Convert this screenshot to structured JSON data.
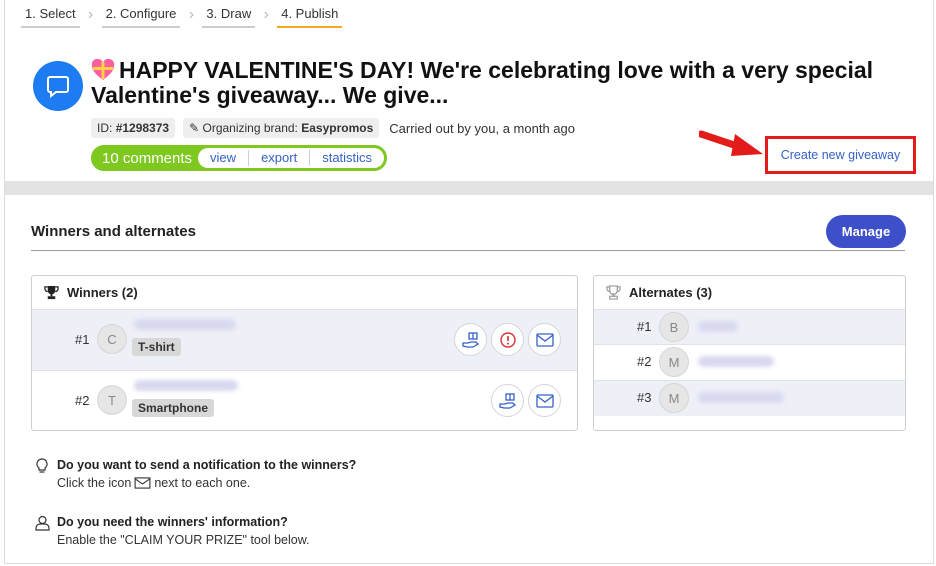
{
  "steps": [
    "1. Select",
    "2. Configure",
    "3. Draw",
    "4. Publish"
  ],
  "active_step": 3,
  "giveaway": {
    "title": "HAPPY VALENTINE'S DAY! We're celebrating love with a very special Valentine's giveaway... We give...",
    "id_label": "ID:",
    "id_value": "#1298373",
    "brand_label": "Organizing brand:",
    "brand_value": "Easypromos",
    "carried_out": "Carried out by you, a month ago",
    "comments_count": "10 comments",
    "links": [
      "view",
      "export",
      "statistics"
    ]
  },
  "create_new": "Create new giveaway",
  "section": {
    "title": "Winners and alternates",
    "manage_label": "Manage"
  },
  "winners": {
    "title": "Winners (2)",
    "rows": [
      {
        "rank": "#1",
        "initial": "C",
        "prize": "T-shirt"
      },
      {
        "rank": "#2",
        "initial": "T",
        "prize": "Smartphone"
      }
    ]
  },
  "alternates": {
    "title": "Alternates (3)",
    "rows": [
      {
        "rank": "#1",
        "initial": "B"
      },
      {
        "rank": "#2",
        "initial": "M"
      },
      {
        "rank": "#3",
        "initial": "M"
      }
    ]
  },
  "tips": {
    "notify_q": "Do you want to send a notification to the winners?",
    "notify_a_pre": "Click the icon",
    "notify_a_post": "next to each one.",
    "info_q": "Do you need the winners' information?",
    "info_a": "Enable the \"CLAIM YOUR PRIZE\" tool below."
  },
  "colors": {
    "accent_blue": "#3d4fc9",
    "comments_green": "#7ec820",
    "highlight_red": "#e31b1b",
    "link_blue": "#3461c8",
    "active_step": "#f5a623"
  }
}
